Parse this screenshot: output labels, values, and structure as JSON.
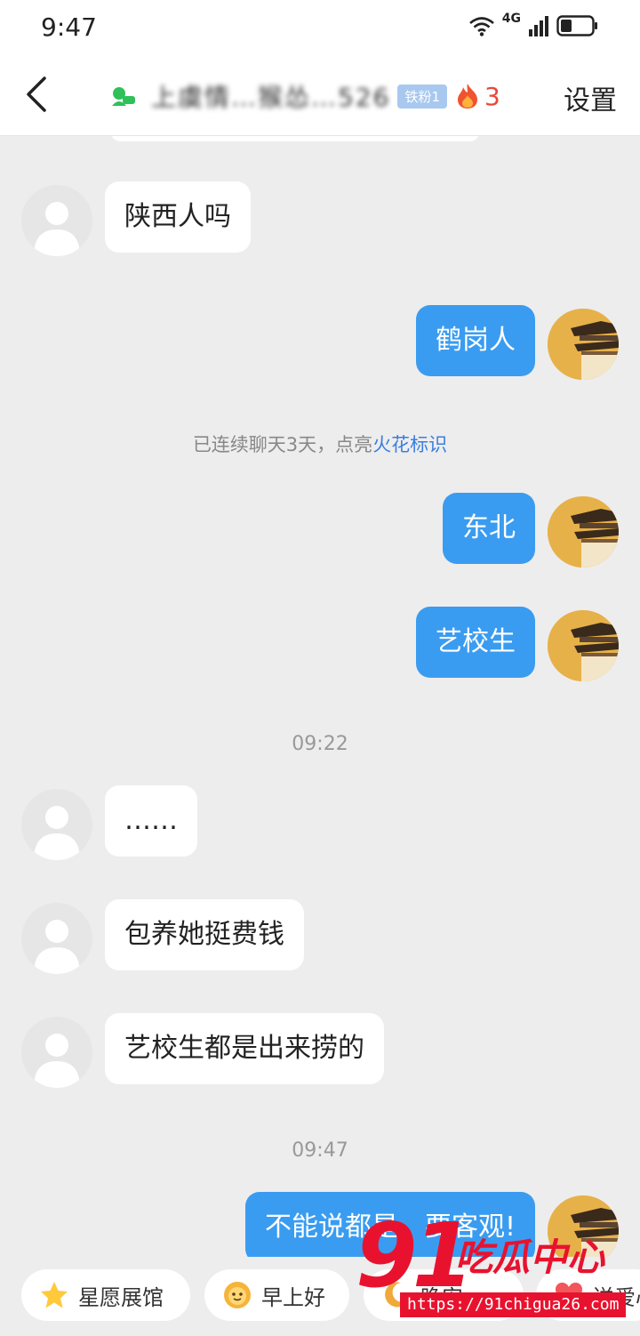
{
  "status_bar": {
    "time": "9:47",
    "network": "4G"
  },
  "header": {
    "title": "上虞情…猴怂…526",
    "fan_badge": "铁粉1",
    "streak_count": "3",
    "settings_label": "设置"
  },
  "messages": [
    {
      "side": "left",
      "text": "陕西人吗"
    },
    {
      "side": "right",
      "text": "鹤岗人"
    },
    {
      "side": "right",
      "text": "东北"
    },
    {
      "side": "right",
      "text": "艺校生"
    },
    {
      "side": "left",
      "text": "……"
    },
    {
      "side": "left",
      "text": "包养她挺费钱"
    },
    {
      "side": "left",
      "text": "艺校生都是出来捞的"
    },
    {
      "side": "right",
      "text": "不能说都是，要客观!"
    }
  ],
  "system_notice": {
    "prefix": "已连续聊天3天，点亮",
    "highlight": "火花标识"
  },
  "timestamps": [
    "09:22",
    "09:47"
  ],
  "quick_replies": [
    "星愿展馆",
    "早上好",
    "晚安",
    "送爱心"
  ],
  "watermark": {
    "number": "91",
    "text": "吃瓜中心",
    "url": "https://91chigua26.com"
  },
  "colors": {
    "sent_bubble": "#3a9cf0",
    "received_bubble": "#ffffff",
    "background": "#ededed",
    "accent_link": "#3b7ee0",
    "streak": "#e8473a",
    "watermark": "#e8122f"
  }
}
